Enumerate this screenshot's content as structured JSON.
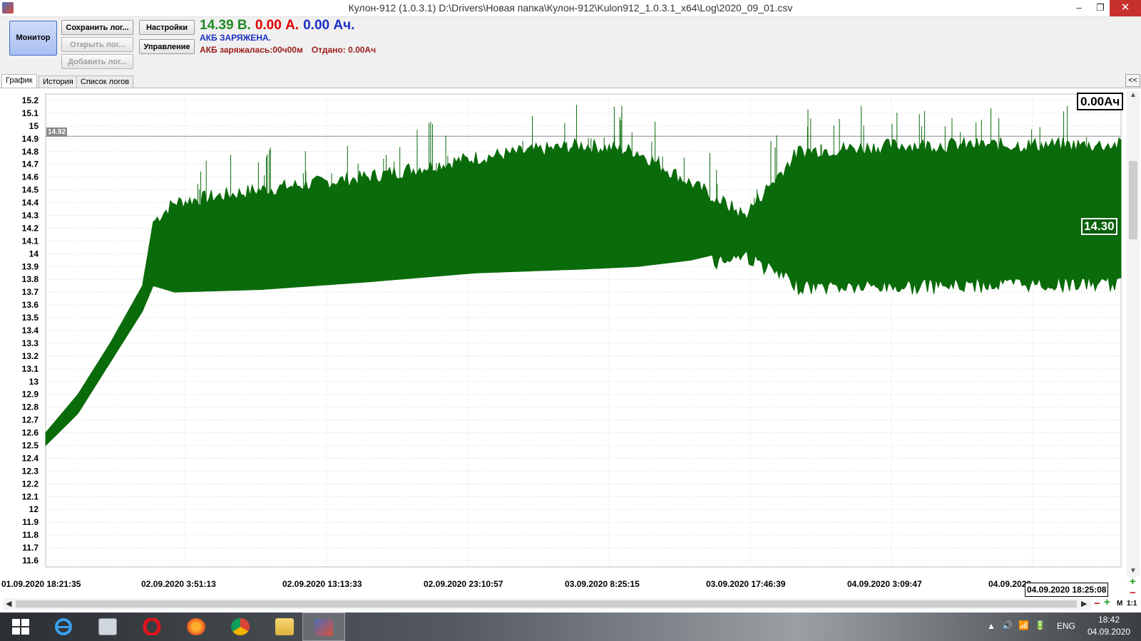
{
  "window": {
    "title": "Кулон-912 (1.0.3.1) D:\\Drivers\\Новая папка\\Кулон-912\\Kulon912_1.0.3.1_x64\\Log\\2020_09_01.csv",
    "min_glyph": "–",
    "max_glyph": "❐",
    "close_glyph": "✕"
  },
  "toolbar": {
    "monitor": "Монитор",
    "save_log": "Сохранить лог...",
    "open_log": "Открыть лог...",
    "add_log": "Добавить лог...",
    "settings": "Настройки",
    "control": "Управление"
  },
  "status": {
    "voltage": "14.39 В.",
    "current": "0.00 А.",
    "capacity": "0.00 Ач.",
    "state": "АКБ ЗАРЯЖЕНА.",
    "charged": "АКБ заряжалась:00ч00м",
    "given": "Отдано: 0.00Ач",
    "colors": {
      "voltage": "#1f8a24",
      "current": "#e00000",
      "capacity": "#1b2fc4",
      "state": "#1b2fc4",
      "charged": "#9b1c1c"
    }
  },
  "tabs": [
    {
      "label": "График",
      "active": true
    },
    {
      "label": "История",
      "active": false
    },
    {
      "label": "Список логов",
      "active": false
    }
  ],
  "collapse_label": "<<",
  "chart_overlay": {
    "ah_total": "0.00Ач",
    "cursor_value": "14.30",
    "reference_tag": "14.92",
    "end_time": "04.09.2020 18:25:08"
  },
  "zoom": {
    "label": "M",
    "ratio": "1:1",
    "plus": "+",
    "minus": "−"
  },
  "chart_data": {
    "type": "area",
    "title": "",
    "xlabel": "",
    "ylabel": "",
    "ylim": [
      11.55,
      15.25
    ],
    "y_ticks": [
      15.2,
      15.1,
      15,
      14.9,
      14.8,
      14.7,
      14.6,
      14.5,
      14.4,
      14.3,
      14.2,
      14.1,
      14,
      13.9,
      13.8,
      13.7,
      13.6,
      13.5,
      13.4,
      13.3,
      13.2,
      13.1,
      13,
      12.9,
      12.8,
      12.7,
      12.6,
      12.5,
      12.4,
      12.3,
      12.2,
      12.1,
      12,
      11.9,
      11.8,
      11.7,
      11.6
    ],
    "x_tick_labels": [
      "01.09.2020 18:21:35",
      "02.09.2020 3:51:13",
      "02.09.2020 13:13:33",
      "02.09.2020 23:10:57",
      "03.09.2020 8:25:15",
      "03.09.2020 17:46:39",
      "04.09.2020 3:09:47",
      "04.09.2020"
    ],
    "reference_line": 14.92,
    "grid": true,
    "line_color": "#0a6b0a",
    "series": [
      {
        "x_fraction": [
          0,
          0.03,
          0.06,
          0.09,
          0.1,
          0.12,
          0.2,
          0.3,
          0.4,
          0.5,
          0.55,
          0.6,
          0.65,
          0.7,
          0.8,
          0.9,
          1.0
        ],
        "upper": [
          12.6,
          12.9,
          13.3,
          13.75,
          14.25,
          14.4,
          14.5,
          14.6,
          14.75,
          14.85,
          14.8,
          14.55,
          14.3,
          14.8,
          14.85,
          14.85,
          14.85
        ],
        "lower": [
          12.5,
          12.75,
          13.15,
          13.55,
          13.75,
          13.7,
          13.72,
          13.78,
          13.85,
          13.88,
          13.9,
          13.95,
          14.05,
          13.8,
          13.8,
          13.82,
          13.82
        ]
      }
    ]
  }
}
